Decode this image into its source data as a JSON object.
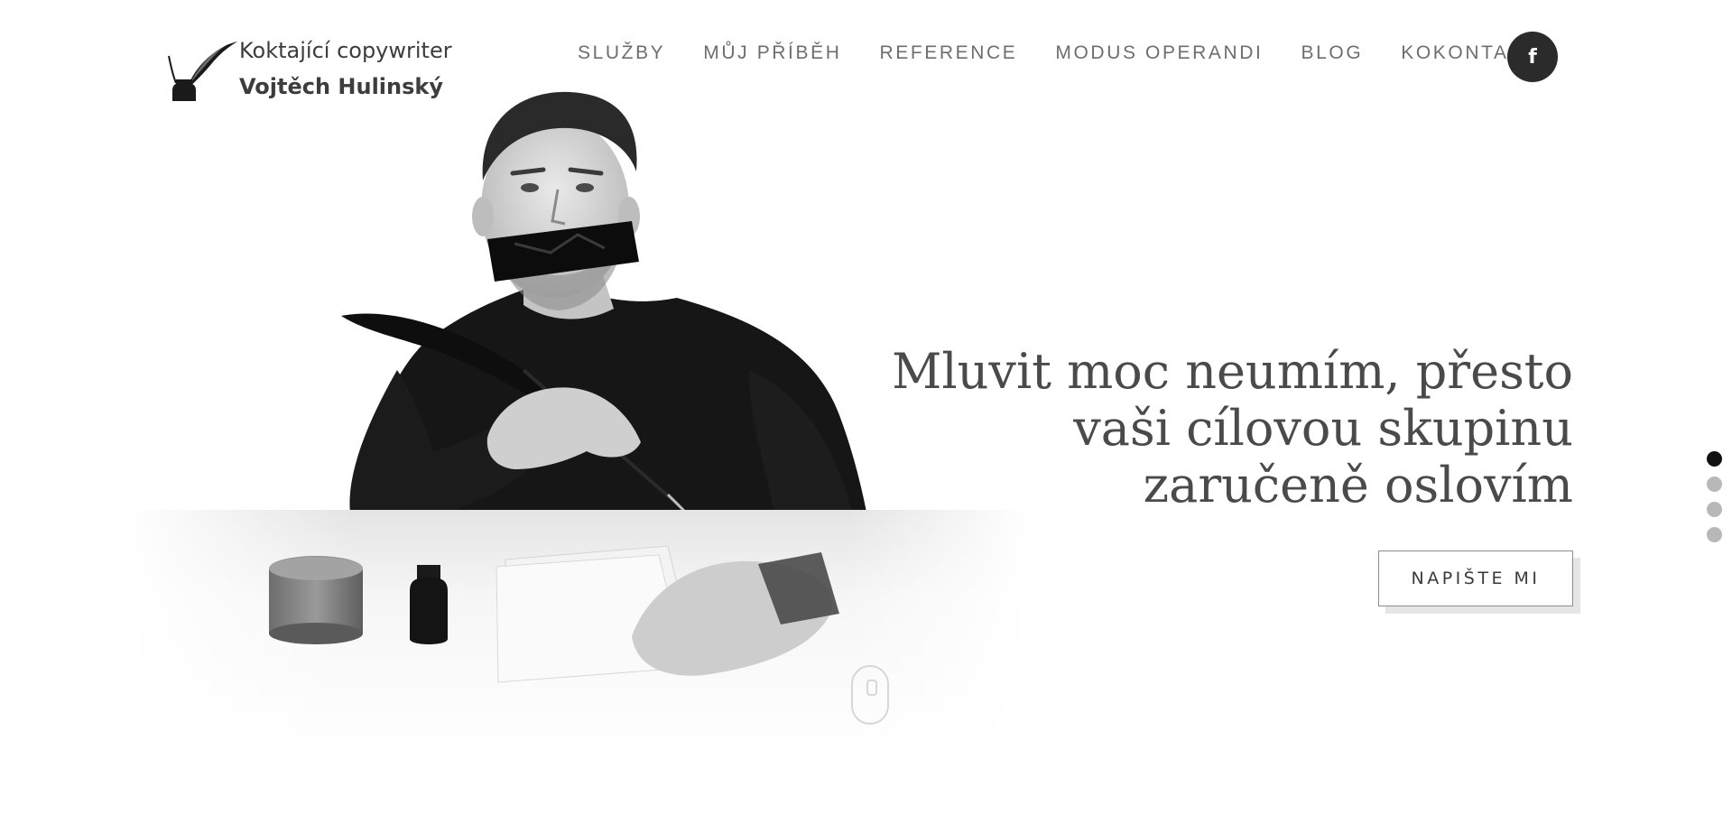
{
  "logo": {
    "line1": "Koktající copywriter",
    "line2": "Vojtěch Hulinský",
    "icon": "quill-pen-icon"
  },
  "nav": {
    "items": [
      "SLUŽBY",
      "MŮJ PŘÍBĚH",
      "REFERENCE",
      "MODUS OPERANDI",
      "BLOG",
      "KOKONTAKT"
    ],
    "facebook_label": "f",
    "facebook_icon": "facebook-icon"
  },
  "hero": {
    "headline": [
      "Mluvit moc neumím, přesto",
      "vaši cílovou skupinu",
      "zaručeně oslovím"
    ],
    "cta": "NAPIŠTE MI",
    "slider_count": 4,
    "slider_active": 1,
    "scroll_icon": "mouse-scroll-icon"
  },
  "colors": {
    "nav_text": "#6e6e6e",
    "headline": "#4a4a4a",
    "dot_active": "#111111",
    "dot_inactive": "#b8b8b8",
    "facebook_bg": "#2b2b2b"
  }
}
